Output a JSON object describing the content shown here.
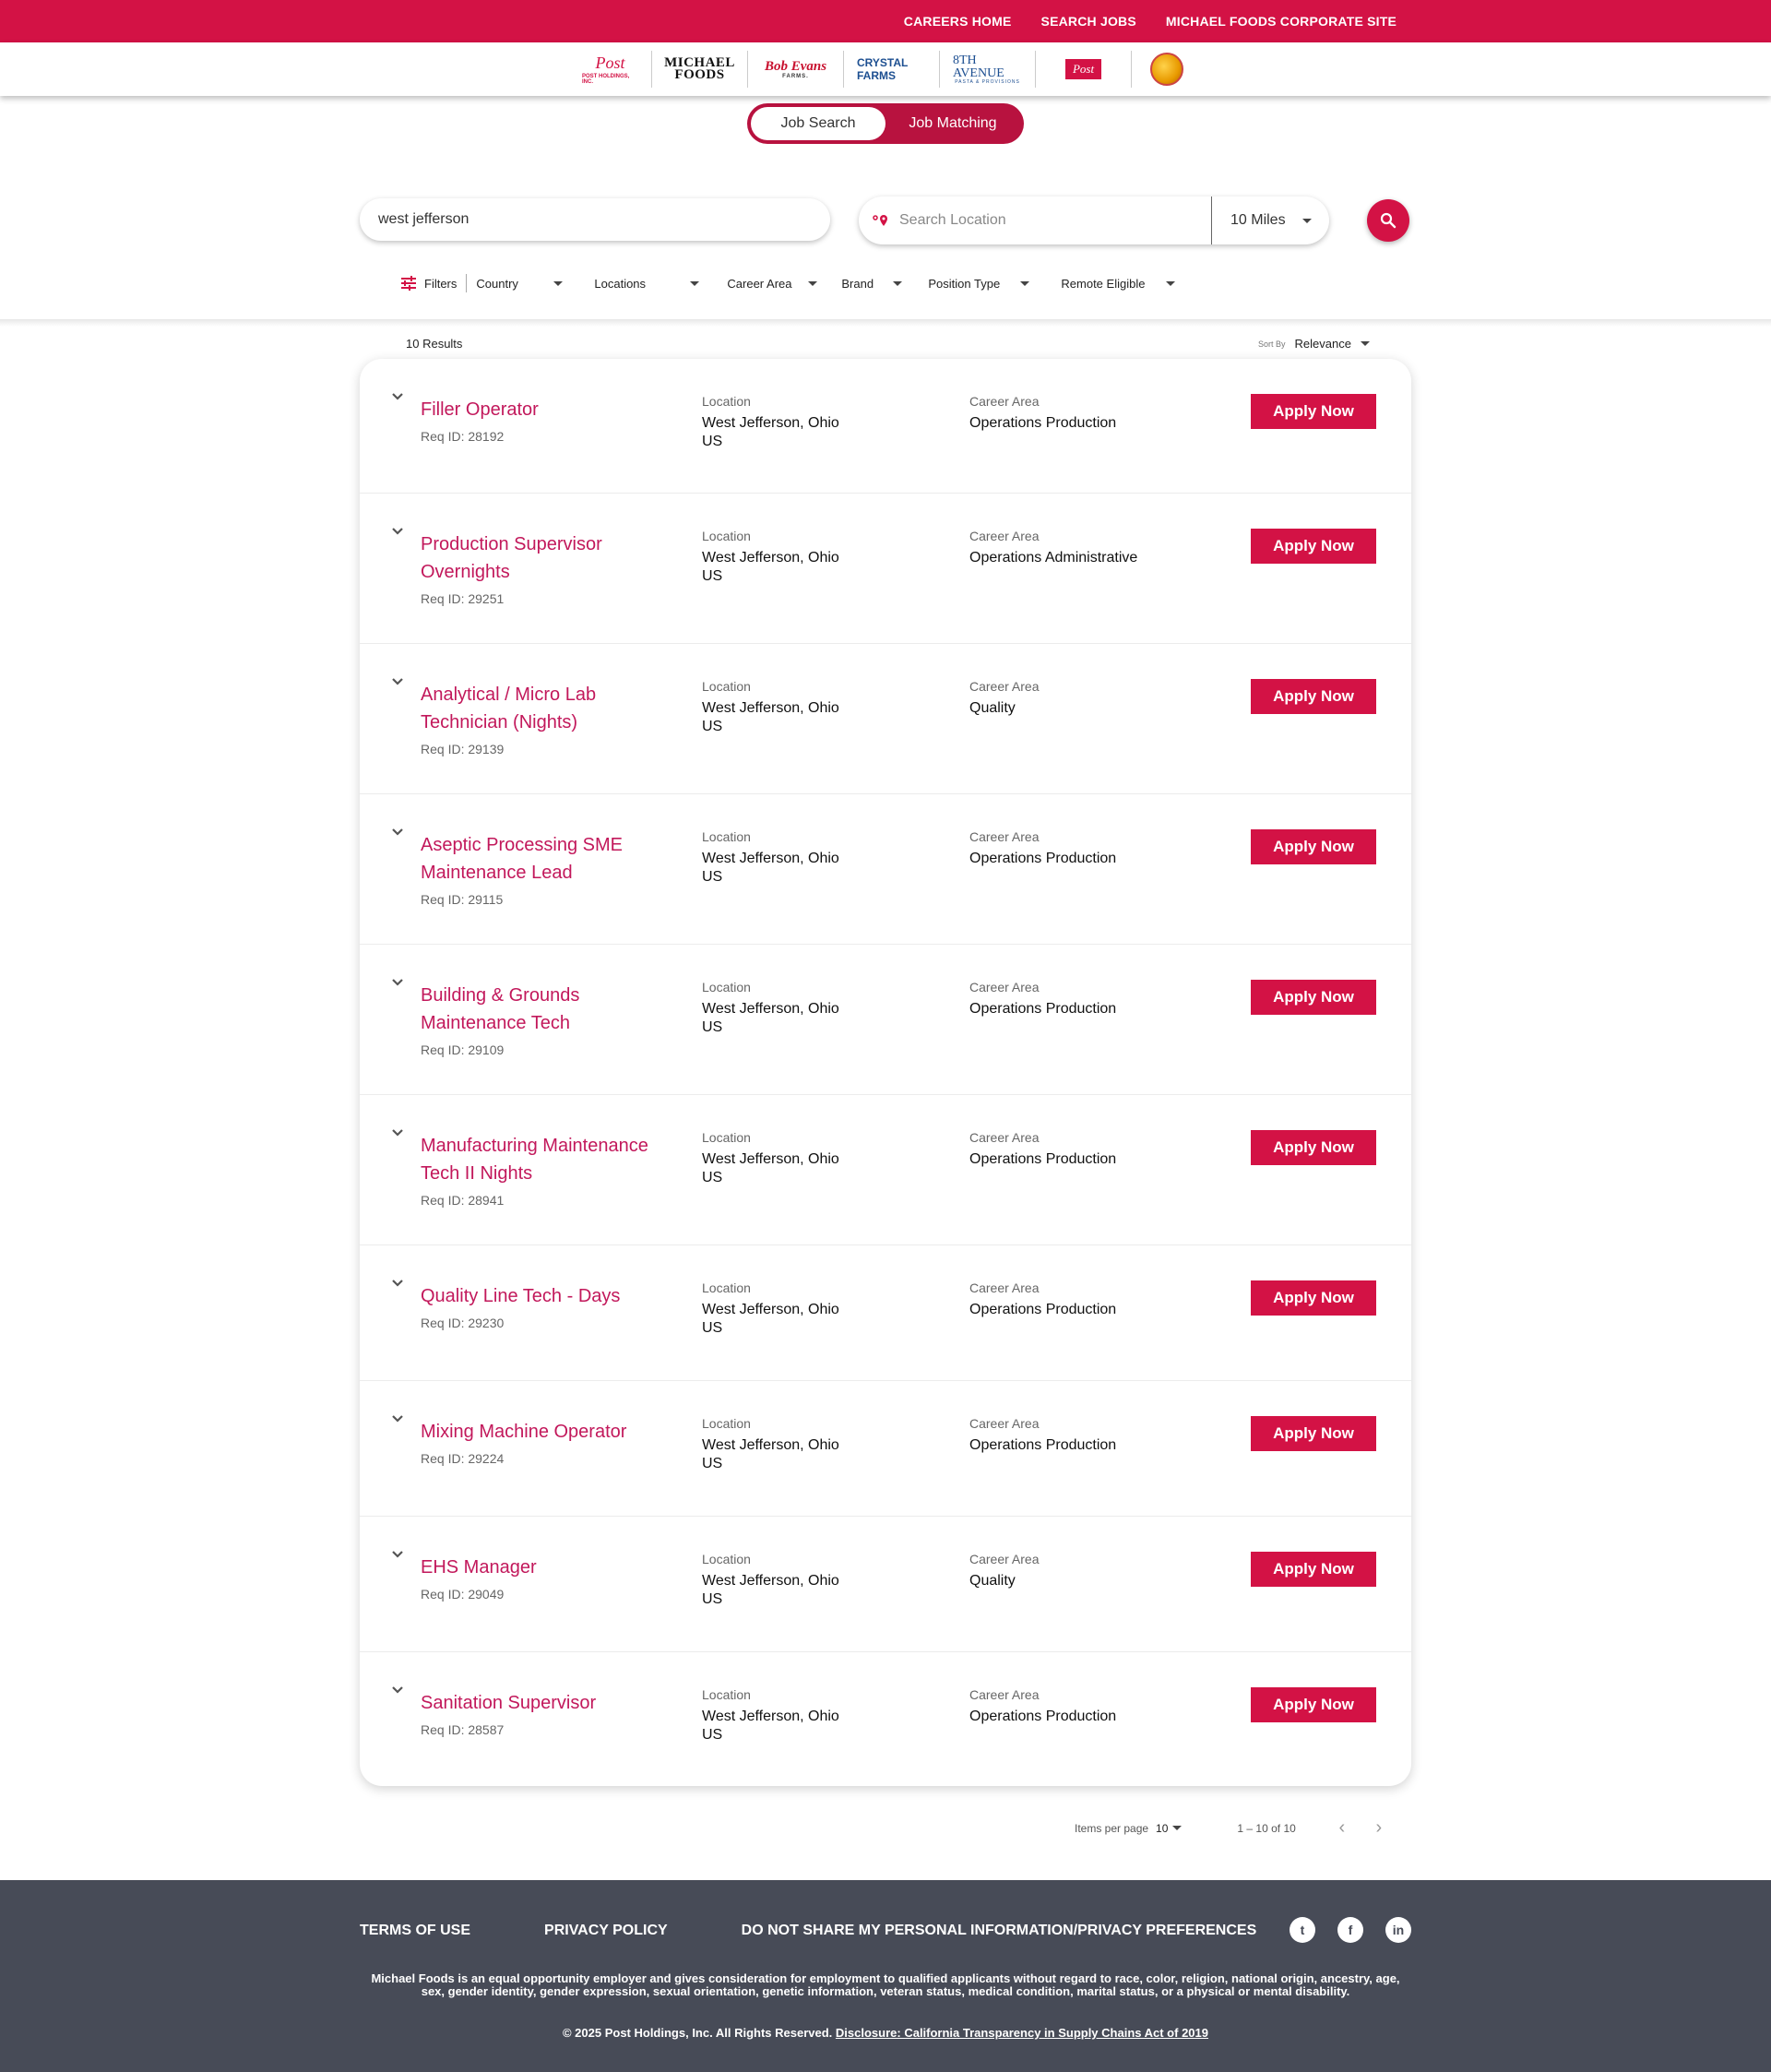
{
  "topnav": {
    "links": [
      "CAREERS HOME",
      "SEARCH JOBS",
      "MICHAEL FOODS CORPORATE SITE"
    ]
  },
  "brands": {
    "post": "Post",
    "post_sub": "POST HOLDINGS, INC.",
    "michael1": "MICHAEL",
    "michael2": "FOODS",
    "bob": "Bob Evans",
    "bob_sub": "FARMS.",
    "crystal": "CRYSTAL FARMS",
    "avenue": "8TH AVENUE",
    "avenue_sub": "PASTA & PROVISIONS",
    "postbrands": "Post"
  },
  "toggle": {
    "job_search": "Job Search",
    "job_matching": "Job Matching"
  },
  "search": {
    "keyword": "west jefferson",
    "location_placeholder": "Search Location",
    "radius": "10 Miles"
  },
  "filters": {
    "label": "Filters",
    "items": [
      "Country",
      "Locations",
      "Career Area",
      "Brand",
      "Position Type",
      "Remote Eligible"
    ]
  },
  "results": {
    "count": "10 Results",
    "sort_label": "Sort By",
    "sort_value": "Relevance",
    "location_label": "Location",
    "area_label": "Career Area",
    "apply_label": "Apply Now",
    "jobs": [
      {
        "title": "Filler Operator",
        "req": "Req ID: 28192",
        "loc1": "West Jefferson, Ohio",
        "loc2": "US",
        "area": "Operations Production"
      },
      {
        "title": "Production Supervisor Overnights",
        "req": "Req ID: 29251",
        "loc1": "West Jefferson, Ohio",
        "loc2": "US",
        "area": "Operations Administrative"
      },
      {
        "title": "Analytical / Micro Lab Technician (Nights)",
        "req": "Req ID: 29139",
        "loc1": "West Jefferson, Ohio",
        "loc2": "US",
        "area": "Quality"
      },
      {
        "title": "Aseptic Processing SME Maintenance Lead",
        "req": "Req ID: 29115",
        "loc1": "West Jefferson, Ohio",
        "loc2": "US",
        "area": "Operations Production"
      },
      {
        "title": "Building & Grounds Maintenance Tech",
        "req": "Req ID: 29109",
        "loc1": "West Jefferson, Ohio",
        "loc2": "US",
        "area": "Operations Production"
      },
      {
        "title": "Manufacturing Maintenance Tech II Nights",
        "req": "Req ID: 28941",
        "loc1": "West Jefferson, Ohio",
        "loc2": "US",
        "area": "Operations Production"
      },
      {
        "title": "Quality Line Tech - Days",
        "req": "Req ID: 29230",
        "loc1": "West Jefferson, Ohio",
        "loc2": "US",
        "area": "Operations Production"
      },
      {
        "title": "Mixing Machine Operator",
        "req": "Req ID: 29224",
        "loc1": "West Jefferson, Ohio",
        "loc2": "US",
        "area": "Operations Production"
      },
      {
        "title": "EHS Manager",
        "req": "Req ID: 29049",
        "loc1": "West Jefferson, Ohio",
        "loc2": "US",
        "area": "Quality"
      },
      {
        "title": "Sanitation Supervisor",
        "req": "Req ID: 28587",
        "loc1": "West Jefferson, Ohio",
        "loc2": "US",
        "area": "Operations Production"
      }
    ]
  },
  "pager": {
    "items_label": "Items per page",
    "items_value": "10",
    "range": "1 – 10 of 10"
  },
  "footer": {
    "links": [
      "TERMS OF USE",
      "PRIVACY POLICY",
      "DO NOT SHARE MY PERSONAL INFORMATION/PRIVACY PREFERENCES"
    ],
    "social": [
      "twitter-icon",
      "facebook-icon",
      "linkedin-icon"
    ],
    "eeo": "Michael Foods is an equal opportunity employer and gives consideration for employment to qualified applicants without regard to race, color, religion, national origin, ancestry, age, sex, gender identity, gender expression, sexual orientation, genetic information, veteran status, medical condition, marital status, or a physical or mental disability.",
    "copyright": "© 2025 Post Holdings, Inc. All Rights Reserved.",
    "disclosure": "Disclosure: California Transparency in Supply Chains Act of 2019"
  },
  "colors": {
    "brand": "#d31245",
    "footer": "#474b57",
    "title": "#c2185b"
  }
}
